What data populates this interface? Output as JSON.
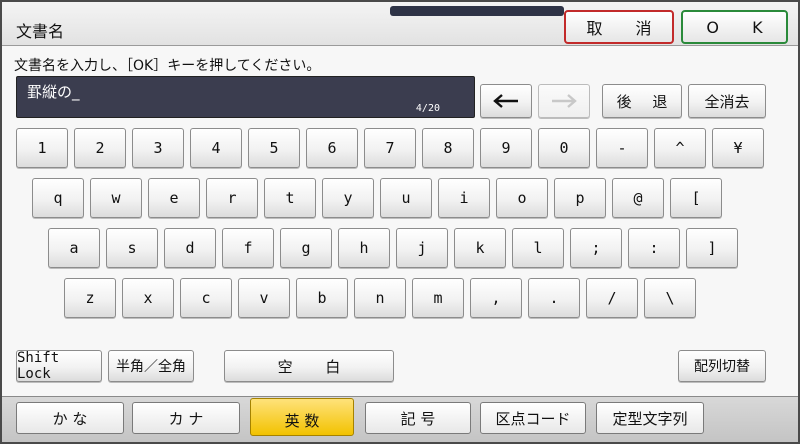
{
  "window": {
    "title": "文書名"
  },
  "header": {
    "cancel_label": "取 消",
    "ok_label": "O K"
  },
  "instruction": "文書名を入力し、［OK］キーを押してください。",
  "input": {
    "value": "罫縦の_",
    "counter": "4/20"
  },
  "edit_keys": {
    "back": "←",
    "forward": "→",
    "backspace": "後 退",
    "clear_all": "全消去"
  },
  "keyboard": {
    "row1": [
      "1",
      "2",
      "3",
      "4",
      "5",
      "6",
      "7",
      "8",
      "9",
      "0",
      "-",
      "^",
      "¥"
    ],
    "row2": [
      "q",
      "w",
      "e",
      "r",
      "t",
      "y",
      "u",
      "i",
      "o",
      "p",
      "@",
      "["
    ],
    "row3": [
      "a",
      "s",
      "d",
      "f",
      "g",
      "h",
      "j",
      "k",
      "l",
      ";",
      ":",
      "]"
    ],
    "row4": [
      "z",
      "x",
      "c",
      "v",
      "b",
      "n",
      "m",
      ",",
      ".",
      "/",
      "\\"
    ]
  },
  "bottom_keys": {
    "shift_lock": "Shift Lock",
    "hankaku": "半角／全角",
    "space": "空 白",
    "layout": "配列切替"
  },
  "tabs": [
    {
      "label": "か な"
    },
    {
      "label": "カ ナ"
    },
    {
      "label": "英 数",
      "active": true
    },
    {
      "label": "記 号"
    },
    {
      "label": "区点コード"
    },
    {
      "label": "定型文字列"
    }
  ],
  "colors": {
    "active_tab": "#f2c200",
    "cancel_border": "#c22a2a",
    "ok_border": "#2a8a3a",
    "input_bg": "#3b3d4f"
  }
}
